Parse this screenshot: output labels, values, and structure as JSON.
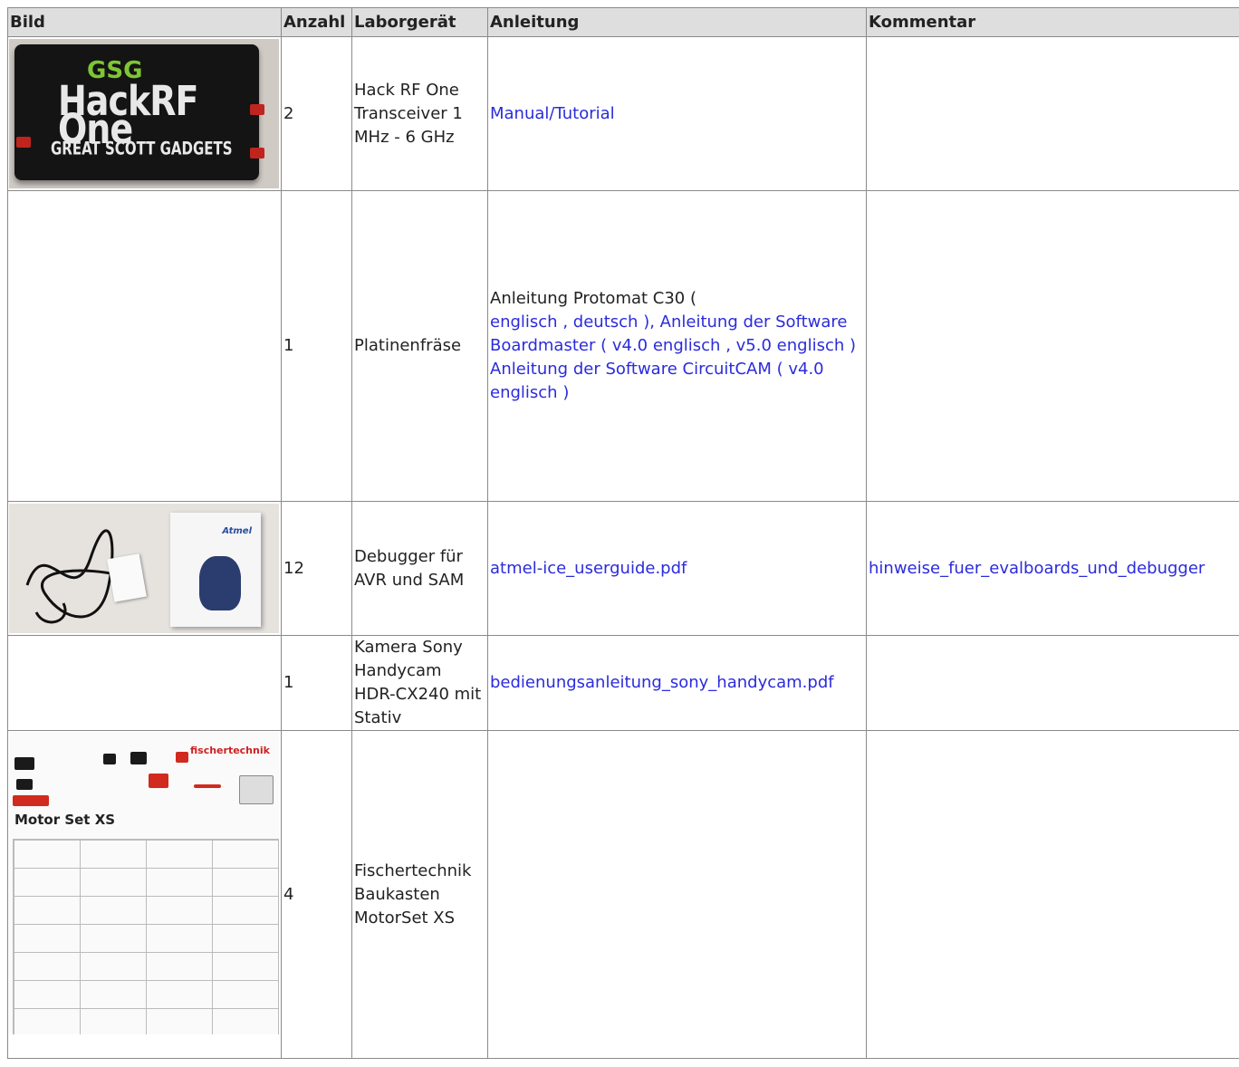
{
  "table": {
    "headers": [
      "Bild",
      "Anzahl",
      "Laborgerät",
      "Anleitung",
      "Kommentar"
    ],
    "rows": [
      {
        "image": "HackRF One photo",
        "count": "2",
        "device": "Hack RF One Transceiver 1 MHz - 6 GHz",
        "manual_link": "Manual/Tutorial",
        "comment": ""
      },
      {
        "count": "1",
        "device": "Platinenfräse",
        "manual_prefix": "Anleitung Protomat C30 (",
        "manual_parts": [
          "englisch",
          ",",
          "deutsch",
          "),",
          "Anleitung der Software Boardmaster (",
          "v4.0 englisch",
          ",",
          "v5.0 englisch",
          ")",
          "Anleitung der Software CircuitCAM (",
          "v4.0 englisch",
          ")"
        ],
        "comment": ""
      },
      {
        "image": "Atmel-ICE debugger photo",
        "count": "12",
        "device": "Debugger für AVR und SAM",
        "manual_link": "atmel-ice_userguide.pdf",
        "comment_link": "hinweise_fuer_evalboards_und_debugger"
      },
      {
        "count": "1",
        "device": "Kamera Sony Handycam HDR-CX240 mit Stativ",
        "manual_link": "bedienungsanleitung_sony_handycam.pdf",
        "comment": ""
      },
      {
        "image": "Fischertechnik Motor Set XS parts list",
        "count": "4",
        "device": "Fischertechnik Baukasten MotorSet XS",
        "manual_link": "",
        "comment": ""
      }
    ]
  },
  "thumbs": {
    "hackrf_logo": "HackRF One",
    "hackrf_sub": "GREAT SCOTT GADGETS",
    "hackrf_gsg": "GSG",
    "atmel_brand": "Atmel",
    "ft_title": "Motor Set XS",
    "ft_brand": "fischertechnik"
  },
  "colors": {
    "link": "#2b2bdd",
    "header_bg": "#dedede",
    "border": "#8a8a8a"
  }
}
